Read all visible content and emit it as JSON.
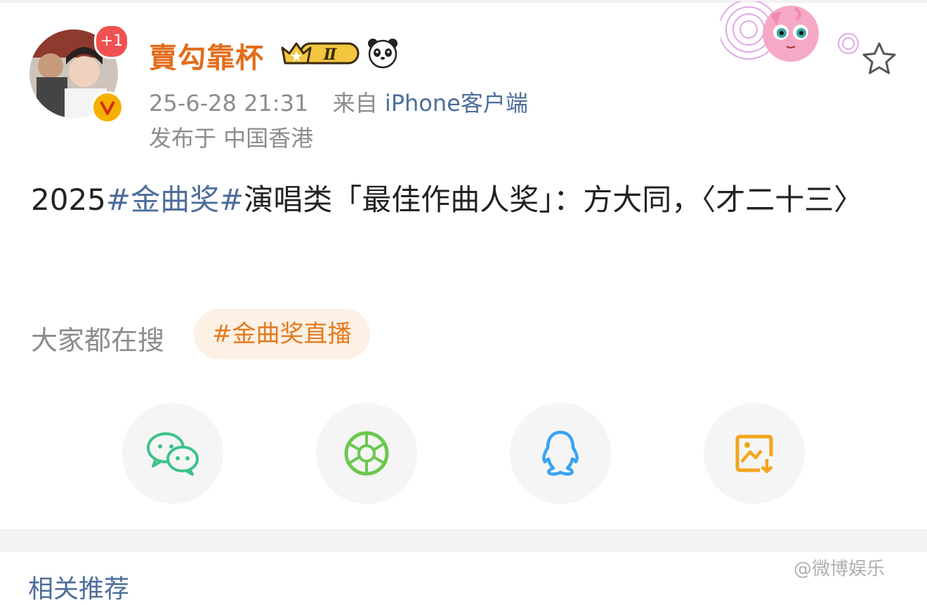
{
  "user": {
    "name": "賣勾靠杯",
    "notification_count": "+1",
    "level_badge": "Ⅱ"
  },
  "post": {
    "time": "25-6-28 21:31",
    "source_prefix": "来自",
    "source": "iPhone客户端",
    "location": "发布于 中国香港",
    "text_prefix": "2025",
    "hashtag": "#金曲奖#",
    "text_body": "演唱类「最佳作曲人奖」：方大同，〈才二十三〉"
  },
  "trending": {
    "label": "大家都在搜",
    "chip": "#金曲奖直播"
  },
  "share": {
    "icons": [
      "wechat-icon",
      "moments-icon",
      "qq-icon",
      "save-image-icon"
    ]
  },
  "related": {
    "title": "相关推荐"
  },
  "watermark": "@微博娱乐"
}
